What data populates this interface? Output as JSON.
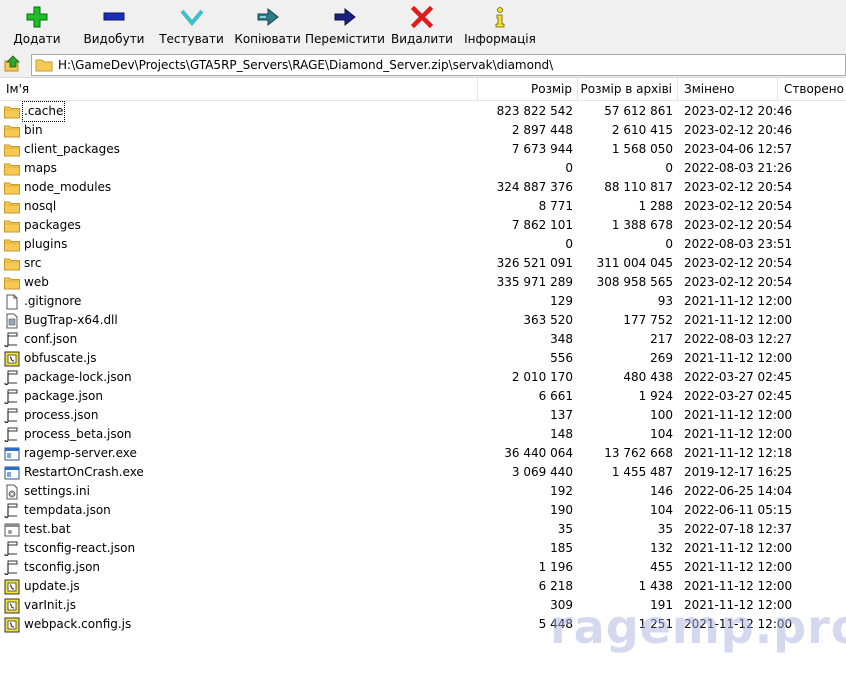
{
  "toolbar": {
    "buttons": [
      {
        "label": "Додати",
        "icon": "add-icon"
      },
      {
        "label": "Видобути",
        "icon": "extract-icon"
      },
      {
        "label": "Тестувати",
        "icon": "test-icon"
      },
      {
        "label": "Копіювати",
        "icon": "copy-icon"
      },
      {
        "label": "Перемістити",
        "icon": "move-icon"
      },
      {
        "label": "Видалити",
        "icon": "delete-icon"
      },
      {
        "label": "Інформація",
        "icon": "info-icon"
      }
    ]
  },
  "address": {
    "path": "H:\\GameDev\\Projects\\GTA5RP_Servers\\RAGE\\Diamond_Server.zip\\servak\\diamond\\"
  },
  "columns": {
    "name": "Ім'я",
    "size": "Розмір",
    "packed": "Розмір в архіві",
    "modified": "Змінено",
    "created": "Створено"
  },
  "files": [
    {
      "name": ".cache",
      "type": "folder",
      "size": "823 822 542",
      "packed": "57 612 861",
      "modified": "2023-02-12 20:46"
    },
    {
      "name": "bin",
      "type": "folder",
      "size": "2 897 448",
      "packed": "2 610 415",
      "modified": "2023-02-12 20:46"
    },
    {
      "name": "client_packages",
      "type": "folder",
      "size": "7 673 944",
      "packed": "1 568 050",
      "modified": "2023-04-06 12:57"
    },
    {
      "name": "maps",
      "type": "folder",
      "size": "0",
      "packed": "0",
      "modified": "2022-08-03 21:26"
    },
    {
      "name": "node_modules",
      "type": "folder",
      "size": "324 887 376",
      "packed": "88 110 817",
      "modified": "2023-02-12 20:54"
    },
    {
      "name": "nosql",
      "type": "folder",
      "size": "8 771",
      "packed": "1 288",
      "modified": "2023-02-12 20:54"
    },
    {
      "name": "packages",
      "type": "folder",
      "size": "7 862 101",
      "packed": "1 388 678",
      "modified": "2023-02-12 20:54"
    },
    {
      "name": "plugins",
      "type": "folder",
      "size": "0",
      "packed": "0",
      "modified": "2022-08-03 23:51"
    },
    {
      "name": "src",
      "type": "folder",
      "size": "326 521 091",
      "packed": "311 004 045",
      "modified": "2023-02-12 20:54"
    },
    {
      "name": "web",
      "type": "folder",
      "size": "335 971 289",
      "packed": "308 958 565",
      "modified": "2023-02-12 20:54"
    },
    {
      "name": ".gitignore",
      "type": "blank",
      "size": "129",
      "packed": "93",
      "modified": "2021-11-12 12:00"
    },
    {
      "name": "BugTrap-x64.dll",
      "type": "dll",
      "size": "363 520",
      "packed": "177 752",
      "modified": "2021-11-12 12:00"
    },
    {
      "name": "conf.json",
      "type": "json",
      "size": "348",
      "packed": "217",
      "modified": "2022-08-03 12:27"
    },
    {
      "name": "obfuscate.js",
      "type": "js",
      "size": "556",
      "packed": "269",
      "modified": "2021-11-12 12:00"
    },
    {
      "name": "package-lock.json",
      "type": "json",
      "size": "2 010 170",
      "packed": "480 438",
      "modified": "2022-03-27 02:45"
    },
    {
      "name": "package.json",
      "type": "json",
      "size": "6 661",
      "packed": "1 924",
      "modified": "2022-03-27 02:45"
    },
    {
      "name": "process.json",
      "type": "json",
      "size": "137",
      "packed": "100",
      "modified": "2021-11-12 12:00"
    },
    {
      "name": "process_beta.json",
      "type": "json",
      "size": "148",
      "packed": "104",
      "modified": "2021-11-12 12:00"
    },
    {
      "name": "ragemp-server.exe",
      "type": "exe",
      "size": "36 440 064",
      "packed": "13 762 668",
      "modified": "2021-11-12 12:18"
    },
    {
      "name": "RestartOnCrash.exe",
      "type": "exe",
      "size": "3 069 440",
      "packed": "1 455 487",
      "modified": "2019-12-17 16:25"
    },
    {
      "name": "settings.ini",
      "type": "ini",
      "size": "192",
      "packed": "146",
      "modified": "2022-06-25 14:04"
    },
    {
      "name": "tempdata.json",
      "type": "json",
      "size": "190",
      "packed": "104",
      "modified": "2022-06-11 05:15"
    },
    {
      "name": "test.bat",
      "type": "bat",
      "size": "35",
      "packed": "35",
      "modified": "2022-07-18 12:37"
    },
    {
      "name": "tsconfig-react.json",
      "type": "json",
      "size": "185",
      "packed": "132",
      "modified": "2021-11-12 12:00"
    },
    {
      "name": "tsconfig.json",
      "type": "json",
      "size": "1 196",
      "packed": "455",
      "modified": "2021-11-12 12:00"
    },
    {
      "name": "update.js",
      "type": "js",
      "size": "6 218",
      "packed": "1 438",
      "modified": "2021-11-12 12:00"
    },
    {
      "name": "varInit.js",
      "type": "js",
      "size": "309",
      "packed": "191",
      "modified": "2021-11-12 12:00"
    },
    {
      "name": "webpack.config.js",
      "type": "js",
      "size": "5 448",
      "packed": "1 251",
      "modified": "2021-11-12 12:00"
    }
  ],
  "watermark": "ragemp.pro",
  "colors": {
    "toolbar_bg": "#f0f0f0",
    "folder": "#f6c955",
    "add_green": "#1fbf2a",
    "extract_blue": "#1a2fb8",
    "test_cyan": "#3bc0c9",
    "delete_red": "#e01b1b",
    "info_yellow": "#f2e033"
  }
}
